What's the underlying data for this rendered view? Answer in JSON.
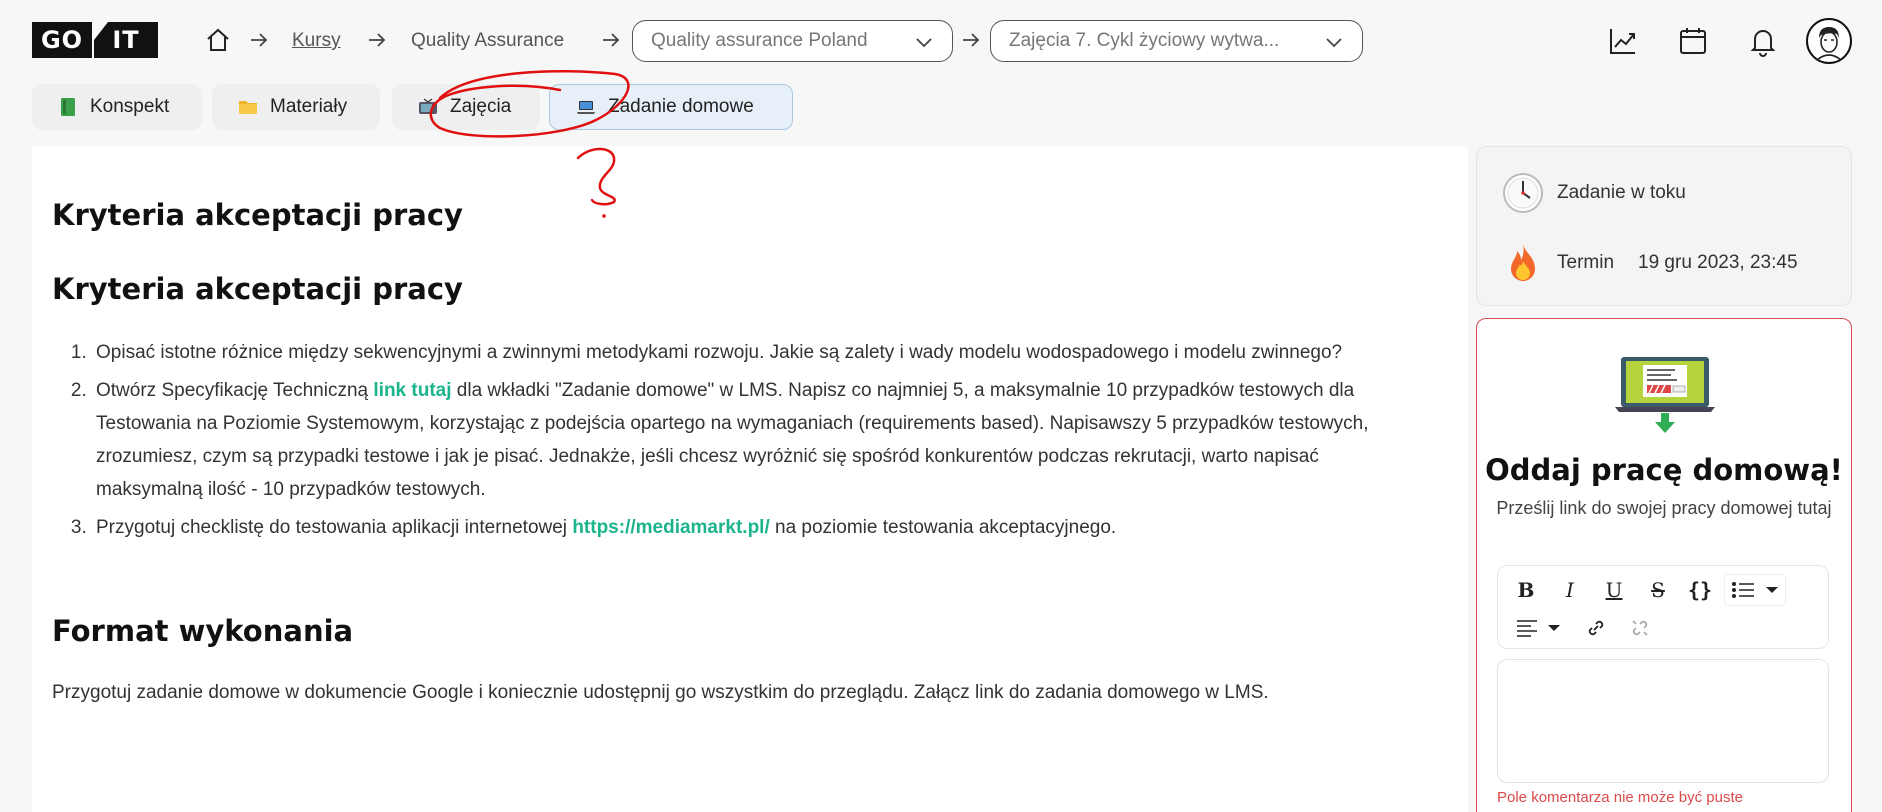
{
  "header": {
    "logo_left": "GO",
    "logo_right": "IT",
    "breadcrumb": {
      "kursy": "Kursy",
      "course": "Quality Assurance",
      "group_select": "Quality assurance Poland",
      "lesson_select": "Zajęcia 7. Cykl życiowy wytwa..."
    },
    "icons": [
      "home-icon",
      "chart-icon",
      "calendar-icon",
      "bell-icon",
      "avatar"
    ]
  },
  "tabs": [
    {
      "label": "Konspekt",
      "icon": "green-book-icon"
    },
    {
      "label": "Materiały",
      "icon": "folder-icon"
    },
    {
      "label": "Zajęcia",
      "icon": "tv-icon"
    },
    {
      "label": "Zadanie domowe",
      "icon": "laptop-icon",
      "active": true
    }
  ],
  "content": {
    "heading1": "Kryteria akceptacji pracy",
    "heading2": "Kryteria akceptacji pracy",
    "items": [
      {
        "text": "Opisać istotne różnice między sekwencyjnymi a zwinnymi metodykami rozwoju. Jakie są zalety i wady modelu wodospadowego i modelu zwinnego?"
      },
      {
        "before": "Otwórz Specyfikację Techniczną ",
        "link": "link tutaj",
        "after": " dla wkładki \"Zadanie domowe\" w LMS. Napisz co najmniej 5, a maksymalnie 10 przypadków testowych dla Testowania na Poziomie Systemowym, korzystając z podejścia opartego na wymaganiach (requirements based). Napisawszy 5 przypadków testowych, zrozumiesz, czym są przypadki testowe i jak je pisać. Jednakże, jeśli chcesz wyróżnić się spośród konkurentów podczas rekrutacji, warto napisać maksymalną ilość - 10 przypadków testowych."
      },
      {
        "before": "Przygotuj checklistę do testowania aplikacji internetowej ",
        "link": "https://mediamarkt.pl/",
        "after": " na poziomie testowania akceptacyjnego."
      }
    ],
    "heading3": "Format wykonania",
    "paragraph": "Przygotuj zadanie domowe w dokumencie Google i koniecznie udostępnij go wszystkim do przeglądu. Załącz link do zadania domowego w LMS."
  },
  "status": {
    "state": "Zadanie w toku",
    "deadline_label": "Termin",
    "deadline_value": "19 gru 2023, 23:45"
  },
  "submit": {
    "title": "Oddaj pracę domową!",
    "subtitle": "Prześlij link do swojej pracy domowej tutaj",
    "toolbar": [
      "B",
      "I",
      "U",
      "S",
      "{}"
    ],
    "error": "Pole komentarza nie może być puste"
  },
  "colors": {
    "accent_green": "#1cb48c",
    "error_red": "#d94a4a",
    "annotation_red": "#e01010"
  }
}
